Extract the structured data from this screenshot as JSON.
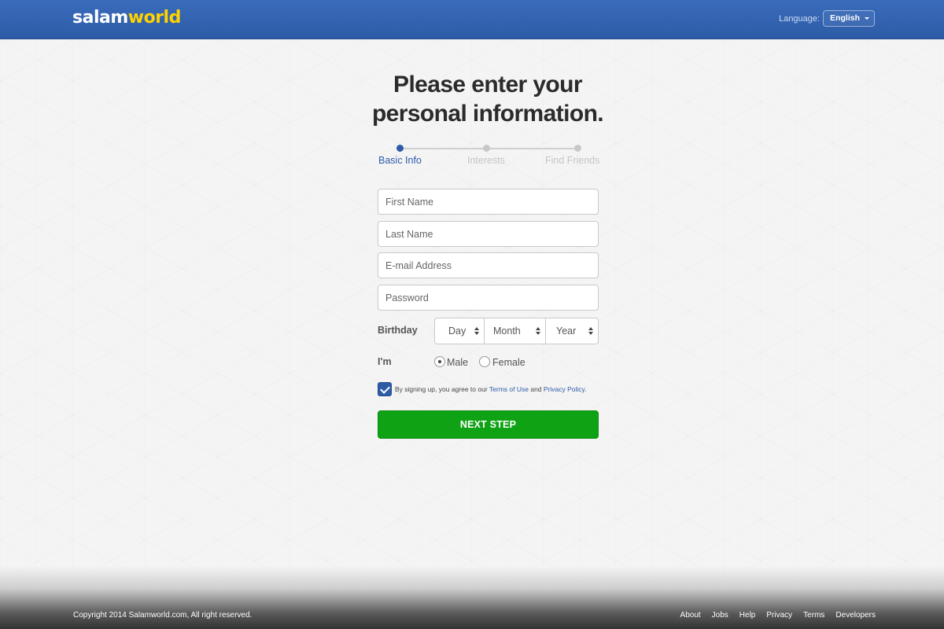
{
  "header": {
    "logo_part1": "salam",
    "logo_part2": "world",
    "language_label": "Language:",
    "language_value": "English"
  },
  "main": {
    "title_line1": "Please enter your",
    "title_line2": "personal information.",
    "steps": [
      {
        "label": "Basic Info",
        "active": true
      },
      {
        "label": "Interests",
        "active": false
      },
      {
        "label": "Find Friends",
        "active": false
      }
    ],
    "progress": 0,
    "fields": {
      "first_name_placeholder": "First Name",
      "last_name_placeholder": "Last Name",
      "email_placeholder": "E-mail Address",
      "password_placeholder": "Password"
    },
    "birthday": {
      "label": "Birthday",
      "day": "Day",
      "month": "Month",
      "year": "Year"
    },
    "gender": {
      "label": "I'm",
      "male": "Male",
      "female": "Female",
      "selected": "Male"
    },
    "terms": {
      "checked": true,
      "prefix": "By signing up, you agree to our",
      "terms_link": "Terms of Use",
      "and": "and",
      "privacy_link": "Privacy Policy."
    },
    "next_button": "NEXT STEP"
  },
  "footer": {
    "copyright": "Copyright 2014 Salamworld.com, All right reserved.",
    "links": [
      "About",
      "Jobs",
      "Help",
      "Privacy",
      "Terms",
      "Developers"
    ]
  },
  "colors": {
    "brand_blue": "#2d5ba6",
    "logo_yellow": "#ffd200",
    "button_green": "#10a215"
  }
}
